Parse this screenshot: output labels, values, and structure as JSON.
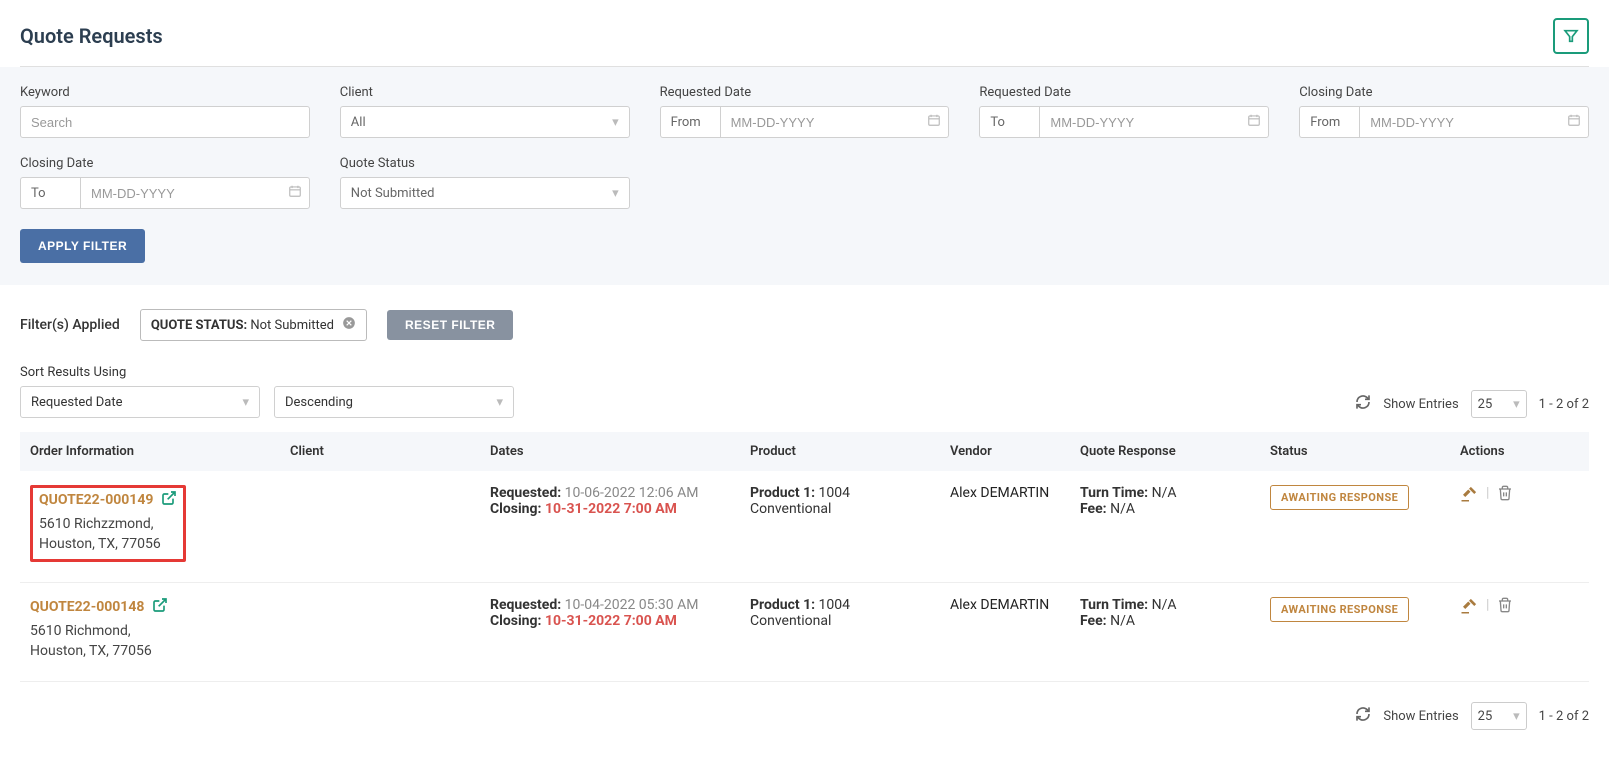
{
  "page": {
    "title": "Quote Requests"
  },
  "filters": {
    "keyword": {
      "label": "Keyword",
      "placeholder": "Search"
    },
    "client": {
      "label": "Client",
      "value": "All"
    },
    "requested_from": {
      "label": "Requested Date",
      "prefix": "From",
      "placeholder": "MM-DD-YYYY"
    },
    "requested_to": {
      "label": "Requested Date",
      "prefix": "To",
      "placeholder": "MM-DD-YYYY"
    },
    "closing_from": {
      "label": "Closing Date",
      "prefix": "From",
      "placeholder": "MM-DD-YYYY"
    },
    "closing_to": {
      "label": "Closing Date",
      "prefix": "To",
      "placeholder": "MM-DD-YYYY"
    },
    "status": {
      "label": "Quote Status",
      "value": "Not Submitted"
    },
    "apply_btn": "APPLY FILTER"
  },
  "applied": {
    "label": "Filter(s) Applied",
    "chip_prefix": "QUOTE STATUS: ",
    "chip_value": "Not Submitted",
    "reset_btn": "RESET FILTER"
  },
  "sort": {
    "label": "Sort Results Using",
    "field": "Requested Date",
    "direction": "Descending"
  },
  "pagination": {
    "show_entries_label": "Show Entries",
    "per_page": "25",
    "range": "1 - 2 of 2"
  },
  "columns": {
    "order": "Order Information",
    "client": "Client",
    "dates": "Dates",
    "product": "Product",
    "vendor": "Vendor",
    "response": "Quote Response",
    "status": "Status",
    "actions": "Actions"
  },
  "labels": {
    "requested": "Requested: ",
    "closing": "Closing: ",
    "product1": "Product 1: ",
    "turn_time": "Turn Time: ",
    "fee": "Fee: "
  },
  "rows": [
    {
      "quote_id": "QUOTE22-000149",
      "addr1": "5610 Richzzmond,",
      "addr2": "Houston, TX, 77056",
      "requested": "10-06-2022 12:06 AM",
      "closing": "10-31-2022 7:00 AM",
      "product": "1004 Conventional",
      "vendor": "Alex DEMARTIN",
      "turn_time": "N/A",
      "fee": "N/A",
      "status": "AWAITING RESPONSE",
      "highlight": true
    },
    {
      "quote_id": "QUOTE22-000148",
      "addr1": "5610 Richmond,",
      "addr2": "Houston, TX, 77056",
      "requested": "10-04-2022 05:30 AM",
      "closing": "10-31-2022 7:00 AM",
      "product": "1004 Conventional",
      "vendor": "Alex DEMARTIN",
      "turn_time": "N/A",
      "fee": "N/A",
      "status": "AWAITING RESPONSE",
      "highlight": false
    }
  ]
}
